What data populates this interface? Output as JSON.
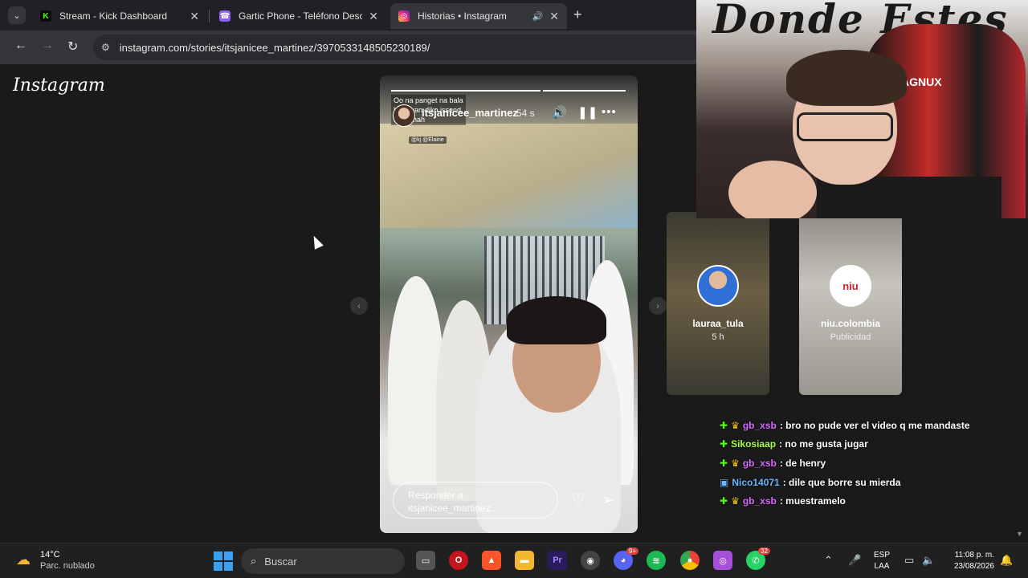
{
  "browser": {
    "tabs": [
      {
        "title": "Stream - Kick Dashboard",
        "icon": "kick-icon",
        "color": "#53fc18"
      },
      {
        "title": "Gartic Phone - Teléfono Descon",
        "icon": "gartic-phone-icon",
        "color": "#8b5cf6"
      },
      {
        "title": "Historias • Instagram",
        "icon": "instagram-icon",
        "color": "#e1306c"
      }
    ],
    "url": "instagram.com/stories/itsjanicee_martinez/3970533148505230189/"
  },
  "instagram": {
    "logo": "Instagram",
    "story": {
      "caption_lines": [
        "Oo na panget na bala",
        "H... dyan-diko issend",
        "t... Hahah"
      ],
      "username": "itsjanicee_martinez",
      "time": "54 s",
      "tag": "@kj @Elaine",
      "reply_placeholder_line1": "Responder a",
      "reply_placeholder_line2": "itsjanicee_martinez..."
    },
    "side_stories": [
      {
        "name": "lauraa_tula",
        "sub": "5 h"
      },
      {
        "name": "niu.colombia",
        "sub": "Publicidad",
        "logo_text": "niu"
      }
    ]
  },
  "webcam": {
    "graffiti": "Donde Estes",
    "chair_brand": "AGNUX"
  },
  "chat": [
    {
      "user": "gb_xsb",
      "color": "#d86bff",
      "msg": ": bro no pude ver el video q me mandaste",
      "badges": 2
    },
    {
      "user": "Sikosiaap",
      "color": "#a8ff3e",
      "msg": ": no me gusta jugar",
      "badges": 1
    },
    {
      "user": "gb_xsb",
      "color": "#d86bff",
      "msg": ": de henry",
      "badges": 2
    },
    {
      "user": "Nico14071",
      "color": "#66b8ff",
      "msg": ": dile que borre su mierda",
      "badges": 1
    },
    {
      "user": "gb_xsb",
      "color": "#d86bff",
      "msg": ": muestramelo",
      "badges": 2
    }
  ],
  "taskbar": {
    "weather_temp": "14°C",
    "weather_desc": "Parc. nublado",
    "search_label": "Buscar",
    "notification_badge_1": "9+",
    "notification_badge_2": "32",
    "lang_1": "ESP",
    "lang_2": "LAA",
    "time": "11:08 p. m.",
    "date": "23/08/2026"
  }
}
